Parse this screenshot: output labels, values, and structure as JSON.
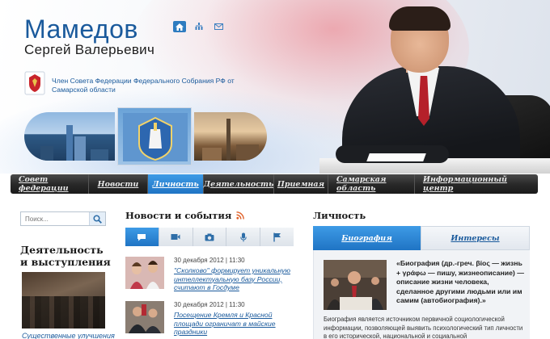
{
  "header": {
    "last_name": "Мамедов",
    "first_names": "Сергей Валерьевич",
    "position": "Член Совета Федерации Федерального Собрания РФ от Самарской области",
    "icons": [
      "home-icon",
      "sitemap-icon",
      "mail-icon"
    ]
  },
  "nav": {
    "items": [
      {
        "label": "Совет федерации"
      },
      {
        "label": "Новости"
      },
      {
        "label": "Личность"
      },
      {
        "label": "Деятельность"
      },
      {
        "label": "Приемная"
      },
      {
        "label": "Самарская область"
      },
      {
        "label": "Информационный центр"
      }
    ],
    "active": "Личность"
  },
  "search": {
    "placeholder": "Поиск..."
  },
  "activities": {
    "title": "Деятельность и выступления",
    "link": "Существенные улучшения"
  },
  "news": {
    "title": "Новости и события",
    "tabs": [
      "chat-icon",
      "video-icon",
      "photo-icon",
      "microphone-icon",
      "flag-icon"
    ],
    "items": [
      {
        "date": "30 декабря 2012 | 11:30",
        "text": "\"Сколково\" формирует уникальную интеллектуальную базу России, считают в Госдуме"
      },
      {
        "date": "30 декабря 2012 | 11:30",
        "text": "Посещение Кремля и Красной площади ограничат в майские праздники"
      }
    ]
  },
  "person": {
    "title": "Личность",
    "tabs": {
      "bio": "Биография",
      "interests": "Интересы"
    },
    "quote": "«Биография (др.-греч. βίος — жизнь + γράφω — пишу, жизнеописание) — описание жизни человека, сделанное другими людьми или им самим (автобиография).»",
    "bio": "Биография является источником первичной социологической информации, позволяющей выявить психологический тип личности в его исторической, национальной и социальной"
  },
  "colors": {
    "brand_blue": "#1a5a9c",
    "active_tab": "#1f74c4",
    "nav_dark": "#2a2a2a"
  }
}
